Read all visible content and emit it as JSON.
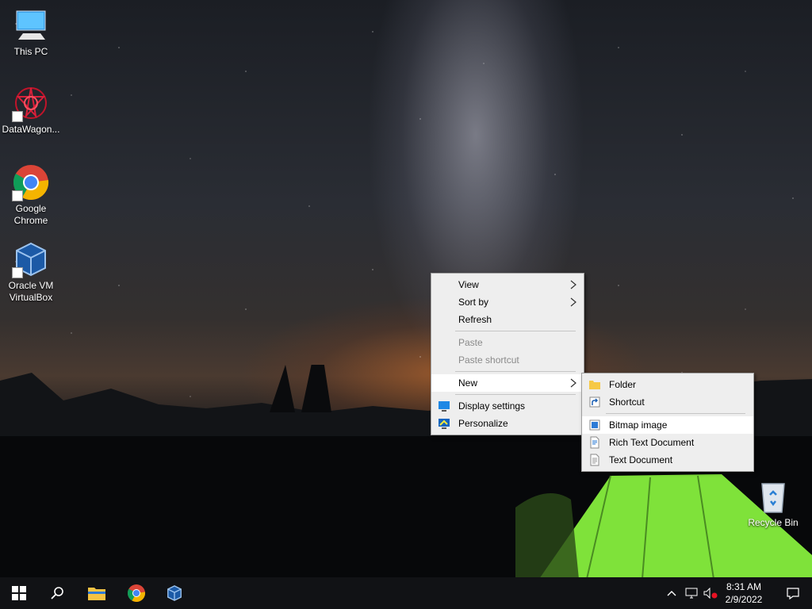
{
  "desktop": {
    "icons": [
      {
        "label": "This PC"
      },
      {
        "label": "DataWagon..."
      },
      {
        "label_line1": "Google",
        "label_line2": "Chrome"
      },
      {
        "label_line1": "Oracle VM",
        "label_line2": "VirtualBox"
      },
      {
        "label": "Recycle Bin"
      }
    ]
  },
  "context_menu": {
    "items": [
      {
        "label": "View",
        "submenu": true,
        "enabled": true
      },
      {
        "label": "Sort by",
        "submenu": true,
        "enabled": true
      },
      {
        "label": "Refresh",
        "enabled": true
      },
      {
        "label": "Paste",
        "enabled": false
      },
      {
        "label": "Paste shortcut",
        "enabled": false
      },
      {
        "label": "New",
        "submenu": true,
        "enabled": true,
        "active": true
      },
      {
        "label": "Display settings",
        "icon": "display-icon"
      },
      {
        "label": "Personalize",
        "icon": "personalize-icon"
      }
    ]
  },
  "new_submenu": {
    "items": [
      {
        "label": "Folder",
        "icon": "folder-icon"
      },
      {
        "label": "Shortcut",
        "icon": "shortcut-icon"
      },
      {
        "label": "Bitmap image",
        "icon": "bitmap-icon",
        "highlighted": true
      },
      {
        "label": "Rich Text Document",
        "icon": "rtf-document-icon"
      },
      {
        "label": "Text Document",
        "icon": "text-document-icon"
      }
    ]
  },
  "taskbar": {
    "pinned": [
      "start-icon",
      "search-icon",
      "file-explorer-icon",
      "chrome-icon",
      "virtualbox-icon"
    ],
    "clock": {
      "time": "8:31 AM",
      "date": "2/9/2022"
    }
  },
  "colors": {
    "menu_bg": "#eeeeee",
    "menu_highlight": "#ffffff",
    "taskbar_bg": "#111215",
    "tent_green": "#7fe23a"
  }
}
